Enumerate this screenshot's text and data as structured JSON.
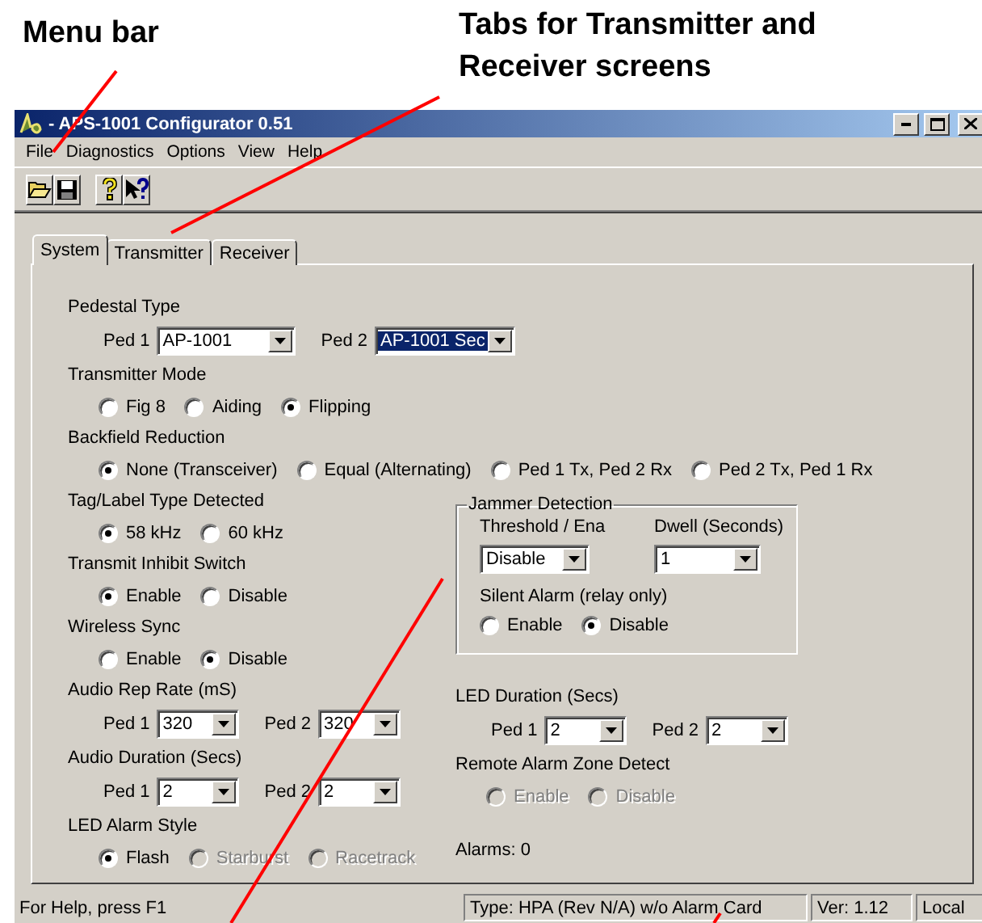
{
  "annotations": [
    {
      "text": "Menu bar"
    },
    {
      "text": "Tabs for Transmitter and Receiver screens"
    }
  ],
  "window": {
    "title": "- APS-1001 Configurator 0.51"
  },
  "menu": [
    "File",
    "Diagnostics",
    "Options",
    "View",
    "Help"
  ],
  "tabs": [
    {
      "label": "System",
      "selected": true
    },
    {
      "label": "Transmitter",
      "selected": false
    },
    {
      "label": "Receiver",
      "selected": false
    }
  ],
  "upper_sections": [
    {
      "label": "Pedestal Type",
      "kind": "combos",
      "combos": [
        {
          "label": "Ped 1",
          "value": "AP-1001",
          "focused": false
        },
        {
          "label": "Ped 2",
          "value": "AP-1001 Sec",
          "focused": true
        }
      ]
    },
    {
      "label": "Transmitter Mode",
      "kind": "radios",
      "options": [
        {
          "label": "Fig 8",
          "selected": false,
          "disabled": false
        },
        {
          "label": "Aiding",
          "selected": false,
          "disabled": false
        },
        {
          "label": "Flipping",
          "selected": true,
          "disabled": false
        }
      ]
    },
    {
      "label": "Backfield Reduction",
      "kind": "radios",
      "options": [
        {
          "label": "None (Transceiver)",
          "selected": true,
          "disabled": false
        },
        {
          "label": "Equal (Alternating)",
          "selected": false,
          "disabled": false
        },
        {
          "label": "Ped 1 Tx, Ped 2 Rx",
          "selected": false,
          "disabled": false
        },
        {
          "label": "Ped 2 Tx, Ped 1 Rx",
          "selected": false,
          "disabled": false
        }
      ]
    }
  ],
  "left_sections": [
    {
      "label": "Tag/Label Type Detected",
      "kind": "radios",
      "options": [
        {
          "label": "58 kHz",
          "selected": true,
          "disabled": false
        },
        {
          "label": "60 kHz",
          "selected": false,
          "disabled": false
        }
      ]
    },
    {
      "label": "Transmit Inhibit Switch",
      "kind": "radios",
      "options": [
        {
          "label": "Enable",
          "selected": true,
          "disabled": false
        },
        {
          "label": "Disable",
          "selected": false,
          "disabled": false
        }
      ]
    },
    {
      "label": "Wireless Sync",
      "kind": "radios",
      "options": [
        {
          "label": "Enable",
          "selected": false,
          "disabled": false
        },
        {
          "label": "Disable",
          "selected": true,
          "disabled": false
        }
      ]
    },
    {
      "label": "Audio Rep Rate (mS)",
      "kind": "combos",
      "combos": [
        {
          "label": "Ped 1",
          "value": "320",
          "focused": false
        },
        {
          "label": "Ped 2",
          "value": "320",
          "focused": false
        }
      ]
    },
    {
      "label": "Audio Duration (Secs)",
      "kind": "combos",
      "combos": [
        {
          "label": "Ped 1",
          "value": "2",
          "focused": false
        },
        {
          "label": "Ped 2",
          "value": "2",
          "focused": false
        }
      ]
    },
    {
      "label": "LED Alarm Style",
      "kind": "radios",
      "options": [
        {
          "label": "Flash",
          "selected": true,
          "disabled": false
        },
        {
          "label": "Starburst",
          "selected": false,
          "disabled": true
        },
        {
          "label": "Racetrack",
          "selected": false,
          "disabled": true
        }
      ]
    }
  ],
  "jammer": {
    "title": "Jammer Detection",
    "threshold": {
      "label": "Threshold / Ena",
      "value": "Disable"
    },
    "dwell": {
      "label": "Dwell (Seconds)",
      "value": "1"
    },
    "silent_alarm": {
      "label": "Silent Alarm (relay only)",
      "options": [
        {
          "label": "Enable",
          "selected": false,
          "disabled": false
        },
        {
          "label": "Disable",
          "selected": true,
          "disabled": false
        }
      ]
    }
  },
  "right_sections": [
    {
      "label": "LED Duration (Secs)",
      "kind": "combos",
      "combos": [
        {
          "label": "Ped 1",
          "value": "2",
          "focused": false
        },
        {
          "label": "Ped 2",
          "value": "2",
          "focused": false
        }
      ]
    },
    {
      "label": "Remote Alarm Zone Detect",
      "kind": "radios",
      "options": [
        {
          "label": "Enable",
          "selected": false,
          "disabled": true
        },
        {
          "label": "Disable",
          "selected": false,
          "disabled": true
        }
      ]
    }
  ],
  "alarms": "Alarms: 0",
  "status_bar": [
    "For Help, press F1",
    "Type: HPA (Rev N/A) w/o Alarm Card",
    "Ver: 1.12",
    "Local"
  ]
}
